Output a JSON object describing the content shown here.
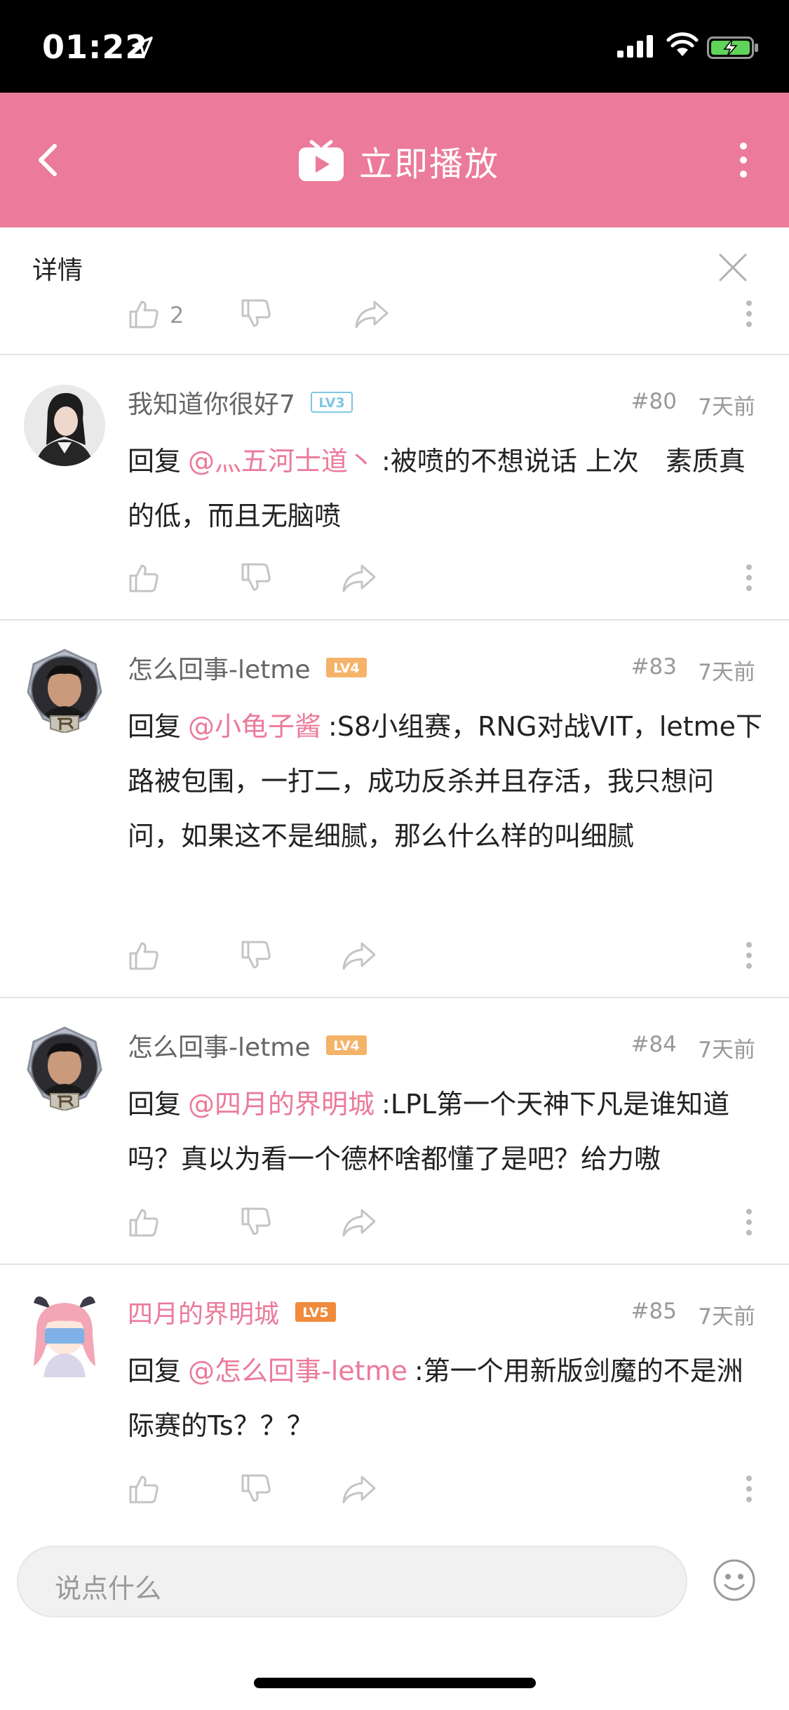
{
  "status_bar": {
    "time": "01:22"
  },
  "nav": {
    "title": "立即播放"
  },
  "details": {
    "label": "详情",
    "prev_like_count": "2"
  },
  "comments": [
    {
      "username": "我知道你很好7",
      "level": "LV3",
      "level_color": "#7fc6e2",
      "name_color": "#666666",
      "floor": "#80",
      "time": "7天前",
      "reply_prefix": "回复",
      "mention": "@灬五河士道丶",
      "text": ":被喷的不想说话 上次　素质真的低，而且无脑喷"
    },
    {
      "username": "怎么回事-letme",
      "level": "LV4",
      "level_color": "#f5b36a",
      "name_color": "#666666",
      "floor": "#83",
      "time": "7天前",
      "reply_prefix": "回复",
      "mention": "@小龟子酱",
      "text": ":S8小组赛，RNG对战VIT，letme下路被包围，一打二，成功反杀并且存活，我只想问问，如果这不是细腻，那么什么样的叫细腻"
    },
    {
      "username": "怎么回事-letme",
      "level": "LV4",
      "level_color": "#f5b36a",
      "name_color": "#666666",
      "floor": "#84",
      "time": "7天前",
      "reply_prefix": "回复",
      "mention": "@四月的界明城",
      "text": ":LPL第一个天神下凡是谁知道吗？真以为看一个德杯啥都懂了是吧？给力嗷"
    },
    {
      "username": "四月的界明城",
      "level": "LV5",
      "level_color": "#f08a3c",
      "name_color": "#eb7a9b",
      "floor": "#85",
      "time": "7天前",
      "reply_prefix": "回复",
      "mention": "@怎么回事-letme",
      "text": ":第一个用新版剑魔的不是洲际赛的Ts？？？"
    }
  ],
  "input": {
    "placeholder": "说点什么"
  },
  "colors": {
    "accent": "#eb7a9b",
    "text": "#222222",
    "muted": "#999999"
  }
}
